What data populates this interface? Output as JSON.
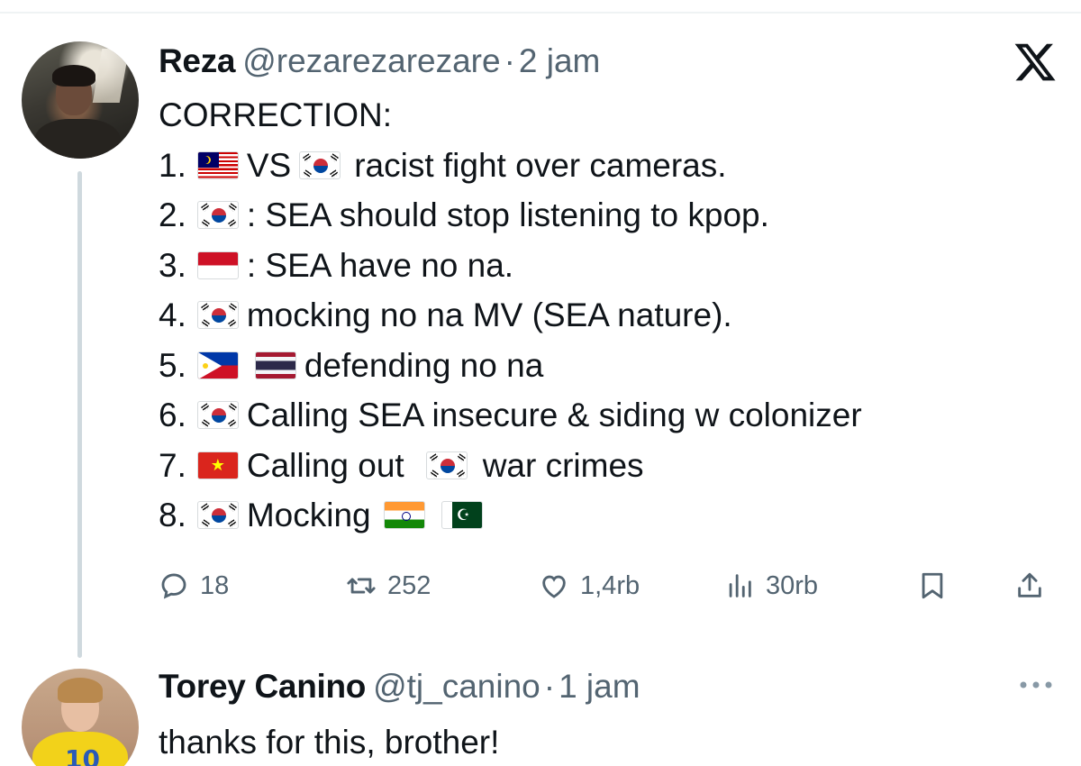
{
  "tweet": {
    "author_name": "Reza",
    "handle": "@rezarezarezare",
    "separator": "·",
    "time": "2 jam",
    "heading": "CORRECTION:",
    "lines": [
      {
        "num": "1.",
        "a": "VS",
        "b": "racist fight over cameras."
      },
      {
        "num": "2.",
        "a": ": SEA should stop listening to kpop."
      },
      {
        "num": "3.",
        "a": ": SEA have no na."
      },
      {
        "num": "4.",
        "a": "mocking no na MV (SEA nature)."
      },
      {
        "num": "5.",
        "a": "defending no na"
      },
      {
        "num": "6.",
        "a": "Calling SEA insecure & siding w colonizer"
      },
      {
        "num": "7.",
        "a": "Calling out",
        "b": "war crimes"
      },
      {
        "num": "8.",
        "a": "Mocking"
      }
    ],
    "flags": {
      "line1": [
        "malaysia-flag",
        "south-korea-flag"
      ],
      "line2": [
        "south-korea-flag"
      ],
      "line3": [
        "indonesia-flag"
      ],
      "line4": [
        "south-korea-flag"
      ],
      "line5": [
        "philippines-flag",
        "thailand-flag"
      ],
      "line6": [
        "south-korea-flag"
      ],
      "line7": [
        "vietnam-flag",
        "south-korea-flag"
      ],
      "line8": [
        "south-korea-flag",
        "india-flag",
        "pakistan-flag"
      ]
    },
    "actions": {
      "replies": "18",
      "reposts": "252",
      "likes": "1,4rb",
      "views": "30rb"
    }
  },
  "reply": {
    "author_name": "Torey Canino",
    "handle": "@tj_canino",
    "separator": "·",
    "time": "1 jam",
    "text": "thanks for this, brother!"
  },
  "icons": {
    "close": "x-logo-icon",
    "reply": "reply-bubble-icon",
    "repost": "repost-arrows-icon",
    "like": "heart-icon",
    "views": "views-bar-chart-icon",
    "bookmark": "bookmark-icon",
    "share": "share-upload-icon",
    "more": "more-dots-icon"
  },
  "colors": {
    "text": "#0f1419",
    "muted": "#536471",
    "thread_line": "#cfd9de"
  }
}
